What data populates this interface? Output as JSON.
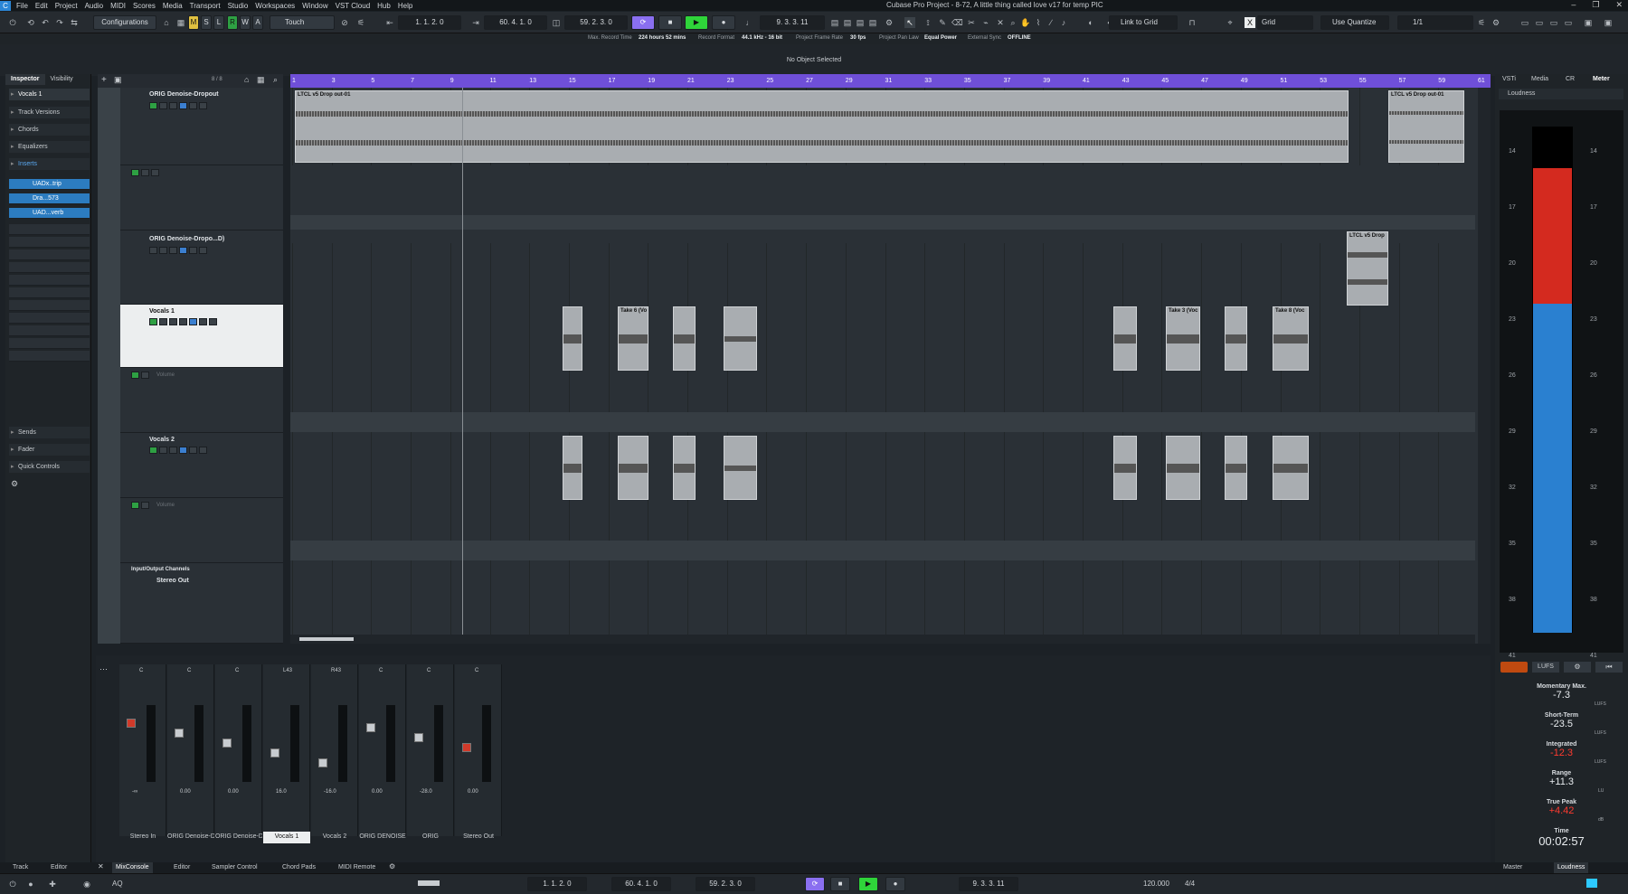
{
  "menu": [
    "File",
    "Edit",
    "Project",
    "Audio",
    "MIDI",
    "Scores",
    "Media",
    "Transport",
    "Studio",
    "Workspaces",
    "Window",
    "VST Cloud",
    "Hub",
    "Help"
  ],
  "window_title": "Cubase Pro Project - 8-72, A little thing called love v17 for temp PIC",
  "toolbar": {
    "configurations": "Configurations",
    "automation_mode": "Touch",
    "m": "M",
    "s": "S",
    "l": "L",
    "r": "R",
    "w": "W",
    "a": "A",
    "left_locator": "1. 1. 2. 0",
    "right_locator": "60. 4. 1. 0",
    "position": "59. 2. 3. 0",
    "punch_pos": "9. 3. 3. 11",
    "link": "Link to Grid",
    "grid": "Grid",
    "quantize": "Use Quantize",
    "quant_value": "1/1"
  },
  "infoline": [
    {
      "label": "Max. Record Time",
      "value": "224 hours 52 mins"
    },
    {
      "label": "Record Format",
      "value": "44.1 kHz - 16 bit"
    },
    {
      "label": "Project Frame Rate",
      "value": "30 fps"
    },
    {
      "label": "Project Pan Law",
      "value": "Equal Power"
    },
    {
      "label": "External Sync",
      "value": "OFFLINE"
    }
  ],
  "status": "No Object Selected",
  "inspector": {
    "tabs": [
      "Inspector",
      "Visibility"
    ],
    "track_name": "Vocals 1",
    "sections": [
      "Track Versions",
      "Chords",
      "Equalizers",
      "Inserts",
      "Sends",
      "Fader",
      "Quick Controls"
    ],
    "inserts": [
      "UADx..trip",
      "Dra...573",
      "UAD...verb"
    ],
    "tracklist_counter": "8 / 8"
  },
  "tracks": [
    {
      "name": "ORIG Denoise-Dropout"
    },
    {
      "name": "ORIG Denoise-Dropo...D)"
    },
    {
      "name": "Vocals 1"
    },
    {
      "name": "Vocals 2"
    },
    {
      "name": "Input/Output Channels"
    },
    {
      "name": "Stereo Out"
    }
  ],
  "automation_labels": [
    "Volume",
    "Volume"
  ],
  "ruler": [
    "1",
    "3",
    "5",
    "7",
    "9",
    "11",
    "13",
    "15",
    "17",
    "19",
    "21",
    "23",
    "25",
    "27",
    "29",
    "31",
    "33",
    "35",
    "37",
    "39",
    "41",
    "43",
    "45",
    "47",
    "49",
    "51",
    "53",
    "55",
    "57",
    "59",
    "61"
  ],
  "events": {
    "e1": "LTCL v5 Drop out-01",
    "e2": "LTCL v5 Drop out-01",
    "e3": "LTCL v5 Drop",
    "t6": "Take 6 (Vo",
    "t3": "Take 3 (Voc",
    "t8": "Take 8 (Voc"
  },
  "right_tabs": [
    "VSTi",
    "Media",
    "CR",
    "Meter"
  ],
  "loudness_title": "Loudness",
  "meter_scale": [
    "14",
    "17",
    "20",
    "23",
    "26",
    "29",
    "32",
    "35",
    "38",
    "41"
  ],
  "loudness": {
    "mom_label": "Momentary Max.",
    "mom": "-7.3",
    "st_label": "Short-Term",
    "st": "-23.5",
    "int_label": "Integrated",
    "int": "-12.3",
    "range_label": "Range",
    "range": "+11.3",
    "tp_label": "True Peak",
    "tp": "+4.42",
    "time_label": "Time",
    "time": "00:02:57",
    "unit": "LUFS",
    "lu": "LU",
    "db": "dB",
    "lufs_btn": "LUFS"
  },
  "mixer": {
    "channels": [
      {
        "name": "Stereo In",
        "vol": "-∞"
      },
      {
        "name": "ORIG Denoise-Dropout",
        "vol": "0.00"
      },
      {
        "name": "ORIG Denoise-Dropout",
        "vol": "0.00"
      },
      {
        "name": "Vocals 1",
        "vol": "16.0"
      },
      {
        "name": "Vocals 2",
        "vol": "-16.0"
      },
      {
        "name": "ORIG DENOISE",
        "vol": "0.00"
      },
      {
        "name": "ORIG",
        "vol": "-28.0"
      },
      {
        "name": "Stereo Out",
        "vol": "0.00"
      }
    ],
    "pan_l": "L43",
    "pan_r": "R43",
    "pan_c": "C"
  },
  "bottom_tabs_left": [
    "Track",
    "Editor"
  ],
  "bottom_tabs_mid": [
    "MixConsole",
    "Editor",
    "Sampler Control",
    "Chord Pads",
    "MIDI Remote"
  ],
  "bottom_tabs_right": [
    "Master",
    "Loudness"
  ],
  "transport": {
    "left": "1. 1. 2. 0",
    "right": "60. 4. 1. 0",
    "pos": "59. 2. 3. 0",
    "punch": "9. 3. 3. 11",
    "tempo": "120.000",
    "sig": "4/4",
    "aq": "AQ"
  },
  "colors": {
    "ruler": "#6f4fd8",
    "play": "#2fd43a",
    "accent": "#2c7cc0",
    "meter_red": "#d42a1f",
    "meter_blue": "#2a80d0"
  }
}
